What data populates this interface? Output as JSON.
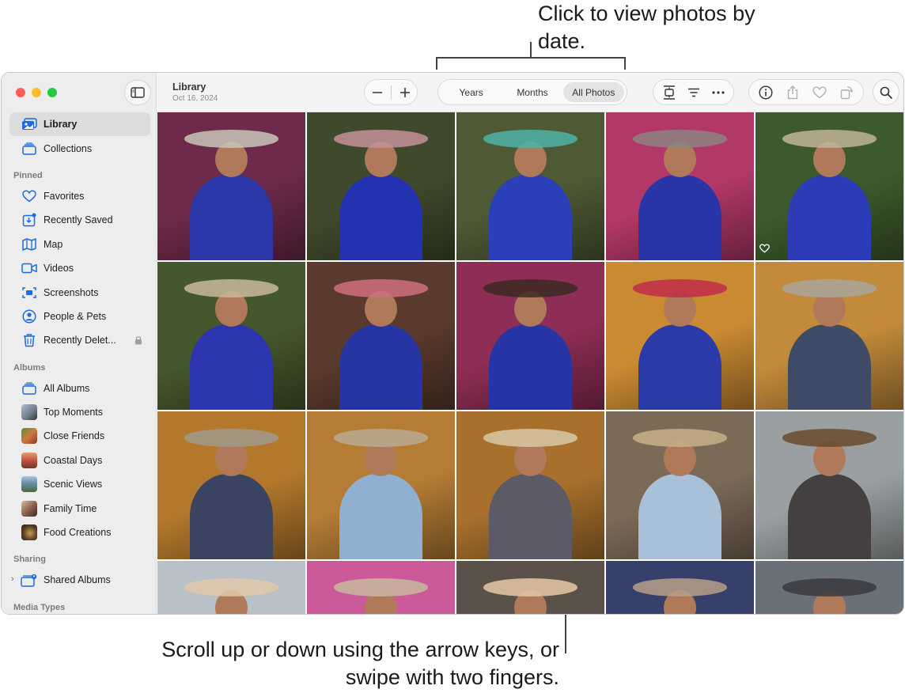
{
  "callouts": {
    "top": "Click to view photos by date.",
    "bottom": "Scroll up or down using the arrow keys, or swipe with two fingers."
  },
  "window": {
    "title": "Library",
    "date": "Oct 16, 2024"
  },
  "toolbar": {
    "zoom_out": "−",
    "zoom_in": "+",
    "segments": [
      {
        "label": "Years",
        "selected": false
      },
      {
        "label": "Months",
        "selected": false
      },
      {
        "label": "All Photos",
        "selected": true
      }
    ]
  },
  "sidebar": {
    "library": "Library",
    "collections": "Collections",
    "pinned_heading": "Pinned",
    "pinned": [
      {
        "label": "Favorites",
        "icon": "heart-icon"
      },
      {
        "label": "Recently Saved",
        "icon": "recently-saved-icon"
      },
      {
        "label": "Map",
        "icon": "map-icon"
      },
      {
        "label": "Videos",
        "icon": "video-icon"
      },
      {
        "label": "Screenshots",
        "icon": "screenshot-icon"
      },
      {
        "label": "People & Pets",
        "icon": "person-icon"
      },
      {
        "label": "Recently Delet...",
        "icon": "trash-icon"
      }
    ],
    "albums_heading": "Albums",
    "albums": [
      {
        "label": "All Albums",
        "icon": "albums-icon"
      },
      {
        "label": "Top Moments",
        "thumb": "#8a96a8"
      },
      {
        "label": "Close Friends",
        "thumb": "#b8643c"
      },
      {
        "label": "Coastal Days",
        "thumb": "#c24a3a"
      },
      {
        "label": "Scenic Views",
        "thumb": "#5f7f9c"
      },
      {
        "label": "Family Time",
        "thumb": "#7a5a48"
      },
      {
        "label": "Food Creations",
        "thumb": "#3a3026"
      }
    ],
    "sharing_heading": "Sharing",
    "shared_albums": "Shared Albums",
    "media_types_heading": "Media Types"
  },
  "photos": [
    {
      "bg": "#6d2a4a",
      "fg": "#2b37a8",
      "accent": "#c9c4b8"
    },
    {
      "bg": "#3f4a2c",
      "fg": "#2432b0",
      "accent": "#c4909a"
    },
    {
      "bg": "#4e5a35",
      "fg": "#2a3fb8",
      "accent": "#4fb3a6"
    },
    {
      "bg": "#b23868",
      "fg": "#2a35a8",
      "accent": "#8c8480"
    },
    {
      "bg": "#3d5a2c",
      "fg": "#2c3cb6",
      "accent": "#c2b49a"
    },
    {
      "bg": "#45572c",
      "fg": "#2c35ad",
      "accent": "#c9b89c"
    },
    {
      "bg": "#5a3a2c",
      "fg": "#2734a4",
      "accent": "#d07080"
    },
    {
      "bg": "#8e2d55",
      "fg": "#2634a6",
      "accent": "#3b2a22"
    },
    {
      "bg": "#c98a32",
      "fg": "#2a3aa8",
      "accent": "#c02c4a"
    },
    {
      "bg": "#c28a3a",
      "fg": "#3e4a66",
      "accent": "#aaa49a"
    },
    {
      "bg": "#b4782c",
      "fg": "#3a4460",
      "accent": "#a09a8c"
    },
    {
      "bg": "#b47c34",
      "fg": "#8fb0d0",
      "accent": "#b8aa92"
    },
    {
      "bg": "#a8702c",
      "fg": "#5c5a66",
      "accent": "#d8c8a4"
    },
    {
      "bg": "#7c6a58",
      "fg": "#a8c0d8",
      "accent": "#c8b08a"
    },
    {
      "bg": "#9aa0a2",
      "fg": "#454040",
      "accent": "#6a4a2c"
    },
    {
      "bg": "#b8c0c8",
      "fg": "#2a3044",
      "accent": "#e0c8a8"
    },
    {
      "bg": "#cc5a9a",
      "fg": "#3a3e54",
      "accent": "#c8b8a0"
    },
    {
      "bg": "#5a5248",
      "fg": "#8a7a6a",
      "accent": "#e8c8a8"
    },
    {
      "bg": "#36406a",
      "fg": "#d8c8b0",
      "accent": "#b8a088"
    },
    {
      "bg": "#6a7078",
      "fg": "#7a6a58",
      "accent": "#3a3a3e"
    }
  ],
  "colors": {
    "sidebar_bg": "#ededed",
    "accent": "#1a6ce0"
  }
}
